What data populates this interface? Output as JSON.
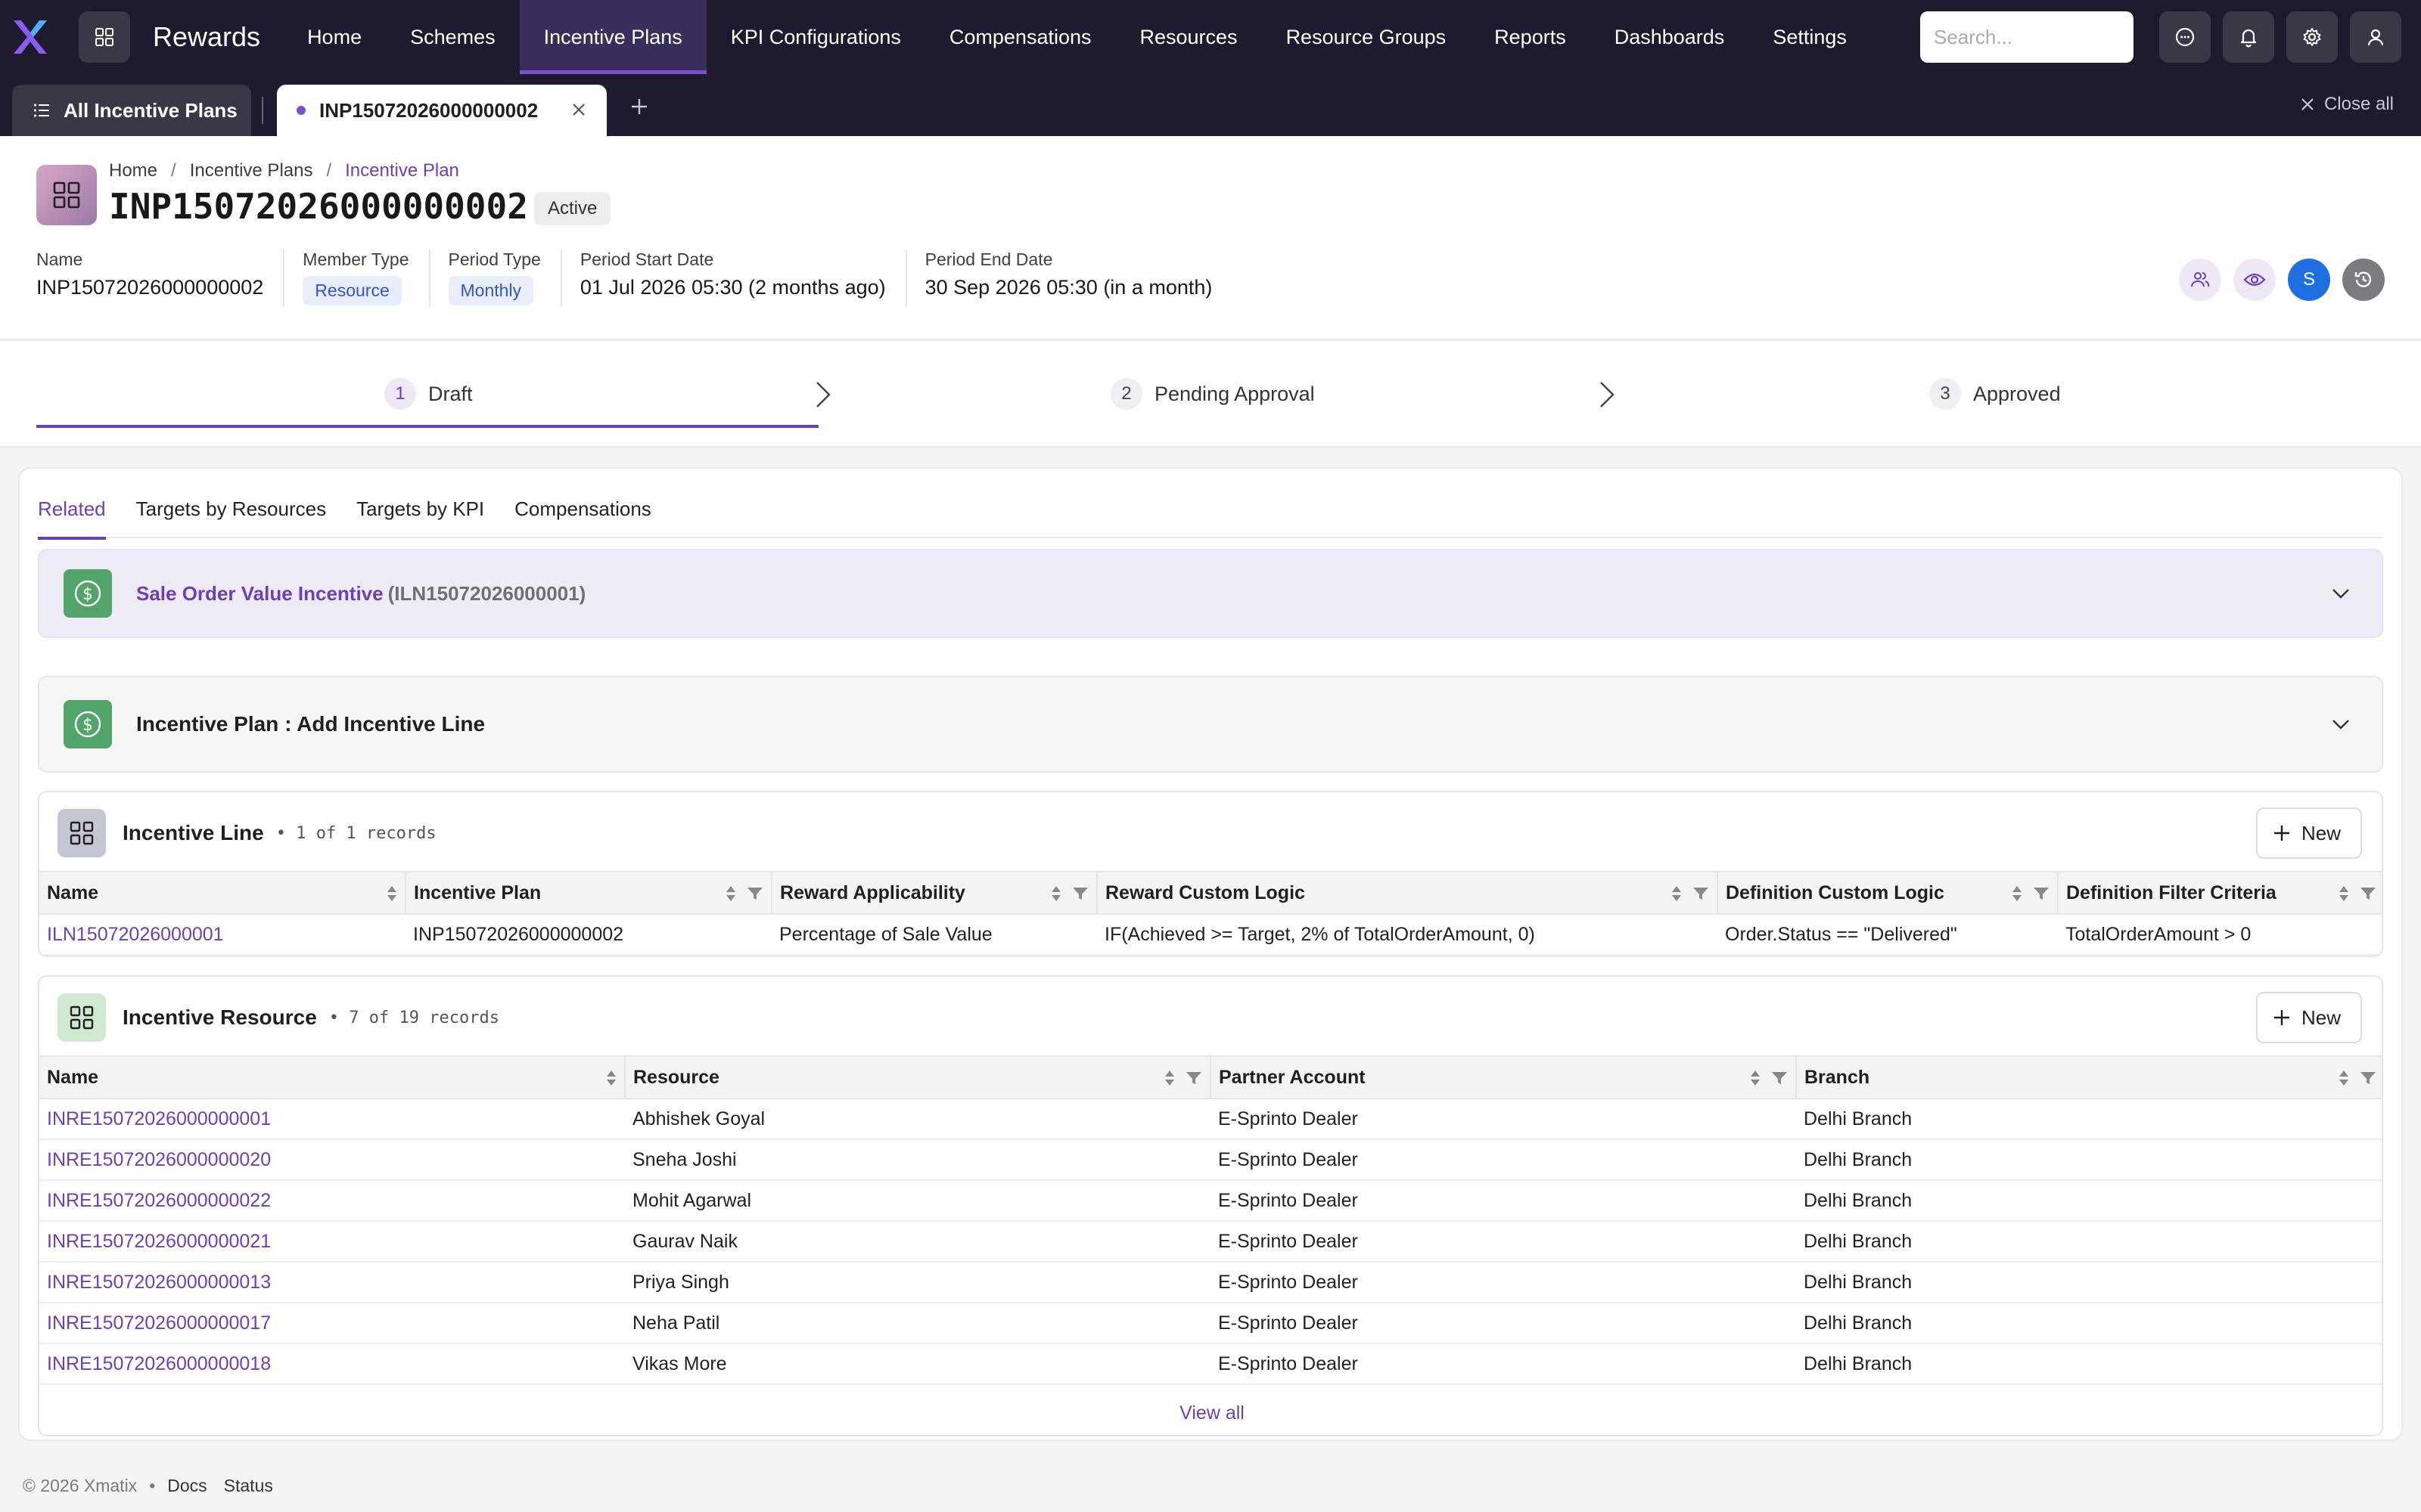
{
  "app": {
    "title": "Rewards"
  },
  "nav": {
    "items": [
      {
        "label": "Home"
      },
      {
        "label": "Schemes"
      },
      {
        "label": "Incentive Plans"
      },
      {
        "label": "KPI Configurations"
      },
      {
        "label": "Compensations"
      },
      {
        "label": "Resources"
      },
      {
        "label": "Resource Groups"
      },
      {
        "label": "Reports"
      },
      {
        "label": "Dashboards"
      },
      {
        "label": "Settings"
      }
    ],
    "active_index": 2,
    "search_placeholder": "Search..."
  },
  "tabs": {
    "all_label": "All Incentive Plans",
    "record_label": "INP15072026000000002",
    "close_all": "Close all"
  },
  "record": {
    "breadcrumb": [
      "Home",
      "Incentive Plans",
      "Incentive Plan"
    ],
    "title": "INP15072026000000002",
    "status": "Active",
    "meta": [
      {
        "label": "Name",
        "value": "INP15072026000000002"
      },
      {
        "label": "Member Type",
        "value": "Resource"
      },
      {
        "label": "Period Type",
        "value": "Monthly"
      },
      {
        "label": "Period Start Date",
        "value": "01 Jul 2026 05:30 (2 months ago)"
      },
      {
        "label": "Period End Date",
        "value": "30 Sep 2026 05:30 (in a month)"
      }
    ],
    "avatar_initial": "S"
  },
  "stepper": {
    "steps": [
      {
        "num": "1",
        "label": "Draft"
      },
      {
        "num": "2",
        "label": "Pending Approval"
      },
      {
        "num": "3",
        "label": "Approved"
      }
    ],
    "active_index": 0
  },
  "subtabs": {
    "items": [
      "Related",
      "Targets by Resources",
      "Targets by KPI",
      "Compensations"
    ],
    "active_index": 0
  },
  "accordion1": {
    "title": "Sale Order Value Incentive",
    "sub": "(ILN15072026000001)"
  },
  "accordion2": {
    "title": "Incentive Plan : Add Incentive Line"
  },
  "incentive_line": {
    "title": "Incentive Line",
    "count": "• 1 of 1 records",
    "new_label": "New",
    "columns": [
      "Name",
      "Incentive Plan",
      "Reward Applicability",
      "Reward Custom Logic",
      "Definition Custom Logic",
      "Definition Filter Criteria"
    ],
    "rows": [
      [
        "ILN15072026000001",
        "INP15072026000000002",
        "Percentage of Sale Value",
        "IF(Achieved >= Target, 2% of TotalOrderAmount, 0)",
        "Order.Status == \"Delivered\"",
        "TotalOrderAmount > 0"
      ]
    ]
  },
  "incentive_resource": {
    "title": "Incentive Resource",
    "count": "• 7 of 19 records",
    "new_label": "New",
    "columns": [
      "Name",
      "Resource",
      "Partner Account",
      "Branch"
    ],
    "rows": [
      [
        "INRE15072026000000001",
        "Abhishek Goyal",
        "E-Sprinto Dealer",
        "Delhi Branch"
      ],
      [
        "INRE15072026000000020",
        "Sneha Joshi",
        "E-Sprinto Dealer",
        "Delhi Branch"
      ],
      [
        "INRE15072026000000022",
        "Mohit Agarwal",
        "E-Sprinto Dealer",
        "Delhi Branch"
      ],
      [
        "INRE15072026000000021",
        "Gaurav Naik",
        "E-Sprinto Dealer",
        "Delhi Branch"
      ],
      [
        "INRE15072026000000013",
        "Priya Singh",
        "E-Sprinto Dealer",
        "Delhi Branch"
      ],
      [
        "INRE15072026000000017",
        "Neha Patil",
        "E-Sprinto Dealer",
        "Delhi Branch"
      ],
      [
        "INRE15072026000000018",
        "Vikas More",
        "E-Sprinto Dealer",
        "Delhi Branch"
      ]
    ],
    "view_all": "View all"
  },
  "footer": {
    "copyright": "© 2026 Xmatix",
    "links": [
      "Docs",
      "Status"
    ]
  },
  "colors": {
    "nav_bg": "#1e1b2e",
    "accent": "#6b3fb5",
    "link": "#6b3fb5",
    "success_icon": "#52a56a"
  },
  "icons": {
    "logo": "x-logo-icon",
    "apps": "grid-icon",
    "search": "search-icon",
    "chat": "chat-bubble-icon",
    "bell": "bell-icon",
    "gear": "gear-icon",
    "user": "user-icon",
    "list": "list-icon",
    "close": "close-icon",
    "plus": "plus-icon",
    "dollar": "dollar-circle-icon",
    "sort": "sort-icon",
    "filter": "filter-icon",
    "chevron_down": "chevron-down-icon",
    "chevron_right": "chevron-right-icon"
  }
}
